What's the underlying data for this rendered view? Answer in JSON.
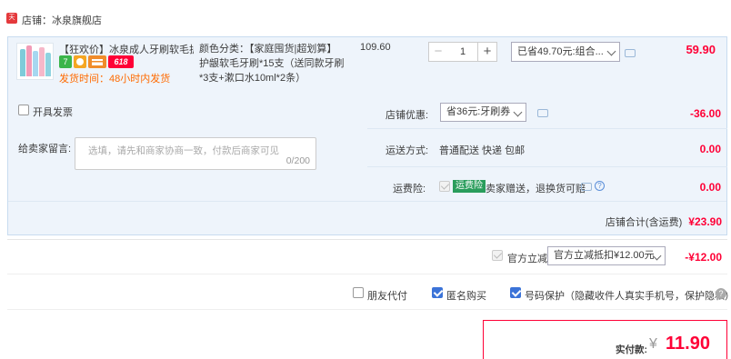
{
  "store": {
    "badge": "天猫",
    "label": "店铺：冰泉旗舰店"
  },
  "product": {
    "name": "【狂欢价】冰泉成人牙刷软毛护...",
    "badges": [
      "7",
      "",
      "",
      "618"
    ],
    "shipping": "发货时间：48小时内发货",
    "spec_lines": [
      "颜色分类：【家庭囤货|超划算】",
      "护龈软毛牙刷*15支（送同款牙刷",
      "*3支+漱口水10ml*2条）"
    ],
    "unit_price": "109.60",
    "quantity": "1",
    "qty_minus": "−",
    "qty_plus": "+",
    "discount_select": "已省49.70元:组合...",
    "total": "59.90"
  },
  "options": {
    "invoice": "开具发票",
    "shop_discount_label": "店铺优惠:",
    "shop_coupon_select": "省36元:牙刷券",
    "shop_discount_amount": "-36.00",
    "message_label": "给卖家留言:",
    "message_placeholder": "选填，请先和商家协商一致，付款后商家可见",
    "message_count": "0/200",
    "delivery_label": "运送方式:",
    "delivery_value": "普通配送 快递 包邮",
    "delivery_amount": "0.00",
    "freight_insurance_label": "运费险:",
    "freight_tag": "运费险",
    "freight_text": "卖家赠送，退换货可赔",
    "freight_amount": "0.00"
  },
  "subtotal": {
    "label": "店铺合计(含运费)",
    "value": "¥23.90"
  },
  "official": {
    "label": "官方立减",
    "select": "官方立减抵扣¥12.00元",
    "amount": "-¥12.00"
  },
  "checks": {
    "friend_pay": "朋友代付",
    "anonymous": "匿名购买",
    "number_protect": "号码保护（隐藏收件人真实手机号，保护隐私）",
    "help": "?"
  },
  "pay": {
    "label": "实付款:",
    "yen": "¥",
    "amount": "11.90"
  },
  "colors": {
    "accent": "#ff0036",
    "panel": "#eef4fb",
    "link": "#3b73d8",
    "ship": "#ff6a00"
  }
}
